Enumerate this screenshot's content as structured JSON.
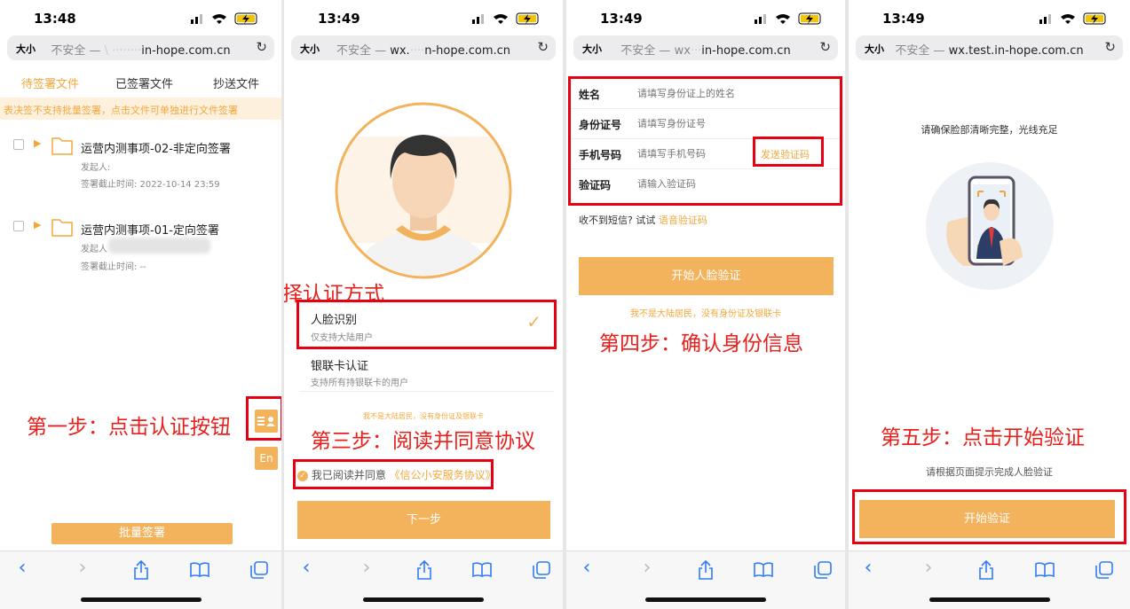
{
  "status_times": [
    "13:48",
    "13:49",
    "13:49",
    "13:49"
  ],
  "browser": {
    "text_size": "大小",
    "insecure": "不安全 —",
    "url1": "in-hope.com.cn",
    "url2_pre": "wx.",
    "url2": "n-hope.com.cn",
    "url3_pre": "wx",
    "url3": "in-hope.com.cn",
    "url4": "wx.test.in-hope.com.cn"
  },
  "p1": {
    "tabs": [
      "待签署文件",
      "已签署文件",
      "抄送文件"
    ],
    "notice": "表决签不支持批量签署，点击文件可单独进行文件签署",
    "files": [
      {
        "title": "运营内测事项-02-非定向签署",
        "initiator": "发起人:",
        "deadline": "签署截止时间: 2022-10-14 23:59"
      },
      {
        "title": "运营内测事项-01-定向签署",
        "initiator": "发起人",
        "deadline": "签署截止时间: --"
      }
    ],
    "step1": "第一步：点击认证按钮",
    "lang": "En",
    "batch": "批量签署"
  },
  "p2": {
    "step2": "第二步：选择认证方式",
    "opt1": {
      "title": "人脸识别",
      "sub": "仅支持大陆用户"
    },
    "opt2": {
      "title": "银联卡认证",
      "sub": "支持所有持银联卡的用户"
    },
    "non_mainland": "我不是大陆居民，没有身份证及银联卡",
    "step3": "第三步：阅读并同意协议",
    "agree": "我已阅读并同意",
    "agreement": "《信公小安服务协议》",
    "next": "下一步"
  },
  "p3": {
    "fields": [
      {
        "label": "姓名",
        "placeholder": "请填写身份证上的姓名"
      },
      {
        "label": "身份证号",
        "placeholder": "请填写身份证号"
      },
      {
        "label": "手机号码",
        "placeholder": "请填写手机号码"
      },
      {
        "label": "验证码",
        "placeholder": "请输入验证码"
      }
    ],
    "send_code": "发送验证码",
    "no_sms": "收不到短信? 试试",
    "voice_code": "语音验证码",
    "start_face": "开始人脸验证",
    "non_mainland": "我不是大陆居民，没有身份证及银联卡",
    "step4": "第四步：确认身份信息"
  },
  "p4": {
    "tip": "请确保脸部清晰完整，光线充足",
    "step5": "第五步：点击开始验证",
    "hint": "请根据页面提示完成人脸验证",
    "start": "开始验证"
  },
  "colors": {
    "accent": "#f3b25c",
    "red": "#e60012",
    "ios_blue": "#2f7bf6"
  }
}
